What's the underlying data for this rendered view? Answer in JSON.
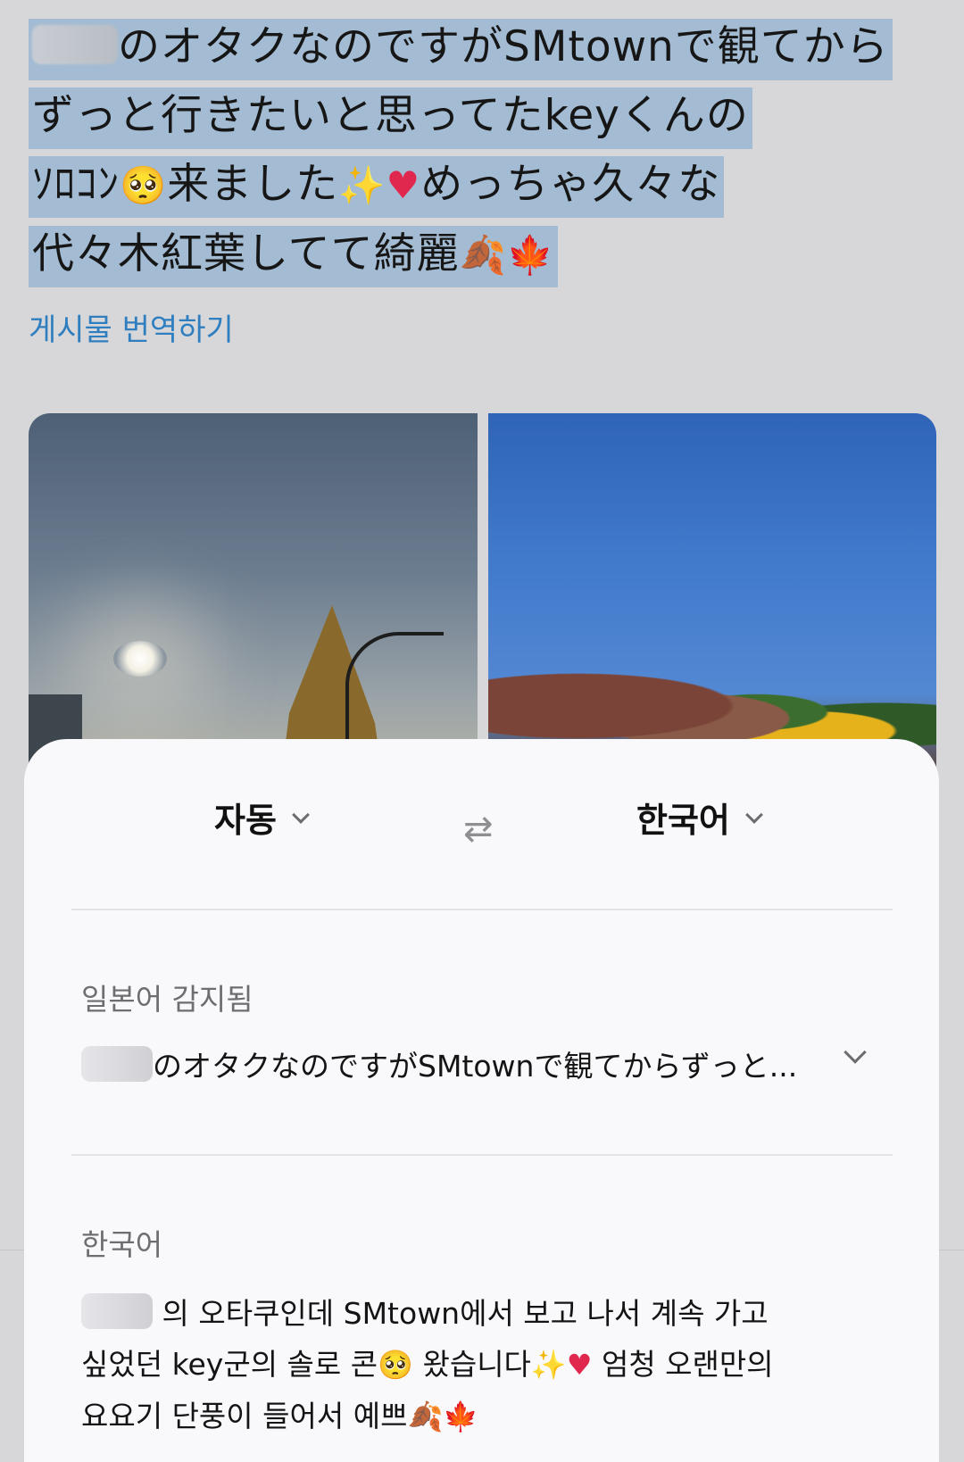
{
  "tweet": {
    "line1": "のオタクなのですがSMtownで観てから",
    "line2": "ずっと行きたいと思ってたkeyくんの",
    "line3_a": "ｿﾛｺﾝ",
    "line3_b": "来ました",
    "line3_c": "めっちゃ久々な",
    "line4": "代々木紅葉してて綺麗",
    "translate_link": "게시물 번역하기"
  },
  "sheet": {
    "source_lang": "자동",
    "target_lang": "한국어",
    "detected_label": "일본어 감지됨",
    "source_text": "のオタクなのですがSMtownで観てからずっと...",
    "target_label": "한국어",
    "target_line1": "의 오타쿠인데 SMtown에서 보고 나서 계속 가고",
    "target_line2_a": "싶었던 key군의 솔로 콘",
    "target_line2_b": "왔습니다",
    "target_line2_c": "엄청 오랜만의",
    "target_line3": "요요기 단풍이 들어서 예쁘"
  },
  "icons": {
    "swap": "swap-arrows-icon",
    "dropdown": "chevron-down-icon",
    "expand": "chevron-down-icon"
  },
  "colors": {
    "highlight": "#a3bcd3",
    "link": "#2f7fc0",
    "sheet_bg": "#f9f9fb",
    "page_bg": "#d7d7d9"
  }
}
